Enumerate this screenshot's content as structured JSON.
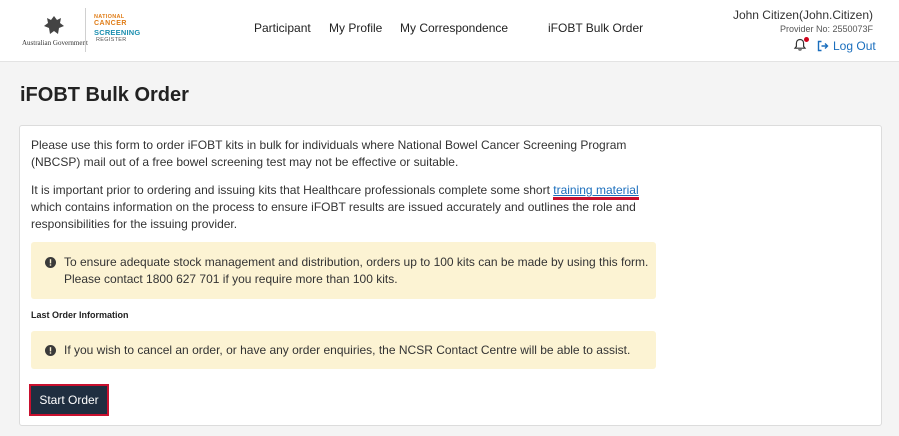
{
  "header": {
    "gov_label": "Australian Government",
    "logo": {
      "line1": "NATIONAL",
      "line2": "CANCER",
      "line3": "SCREENING",
      "line4": "REGISTER"
    },
    "nav": [
      {
        "label": "Participant"
      },
      {
        "label": "My Profile"
      },
      {
        "label": "My Correspondence"
      },
      {
        "label": "iFOBT Bulk Order"
      }
    ],
    "user_name": "John Citizen(John.Citizen)",
    "provider_no": "Provider No: 2550073F",
    "logout_label": "Log Out",
    "notification_icon": "bell-icon",
    "logout_icon": "sign-out-icon"
  },
  "page": {
    "title": "iFOBT Bulk Order",
    "para1": "Please use this form to order iFOBT kits in bulk for individuals where National Bowel Cancer Screening Program (NBCSP) mail out of a free bowel screening test may not be effective or suitable.",
    "para2_before": "It is important prior to ordering and issuing kits that Healthcare professionals complete some short ",
    "para2_link": "training material",
    "para2_after": " which contains information on the process to ensure iFOBT results are issued accurately and outlines the role and responsibilities for the issuing provider.",
    "alert1_line1": "To ensure adequate stock management and distribution, orders up to 100 kits can be made by using this form.",
    "alert1_line2": "Please contact 1800 627 701 if you require more than 100 kits.",
    "last_order_label": "Last Order Information",
    "alert2": "If you wish to cancel an order, or have any order enquiries, the NCSR Contact Centre will be able to assist.",
    "start_order_label": "Start Order",
    "alert_icon": "exclamation-circle-icon"
  },
  "colors": {
    "link": "#1a6ebd",
    "highlight": "#c8102e",
    "alert_bg": "#fcf3d3",
    "button_bg": "#1f2e40",
    "logo_orange": "#e07d18",
    "logo_teal": "#1b8fb0"
  }
}
